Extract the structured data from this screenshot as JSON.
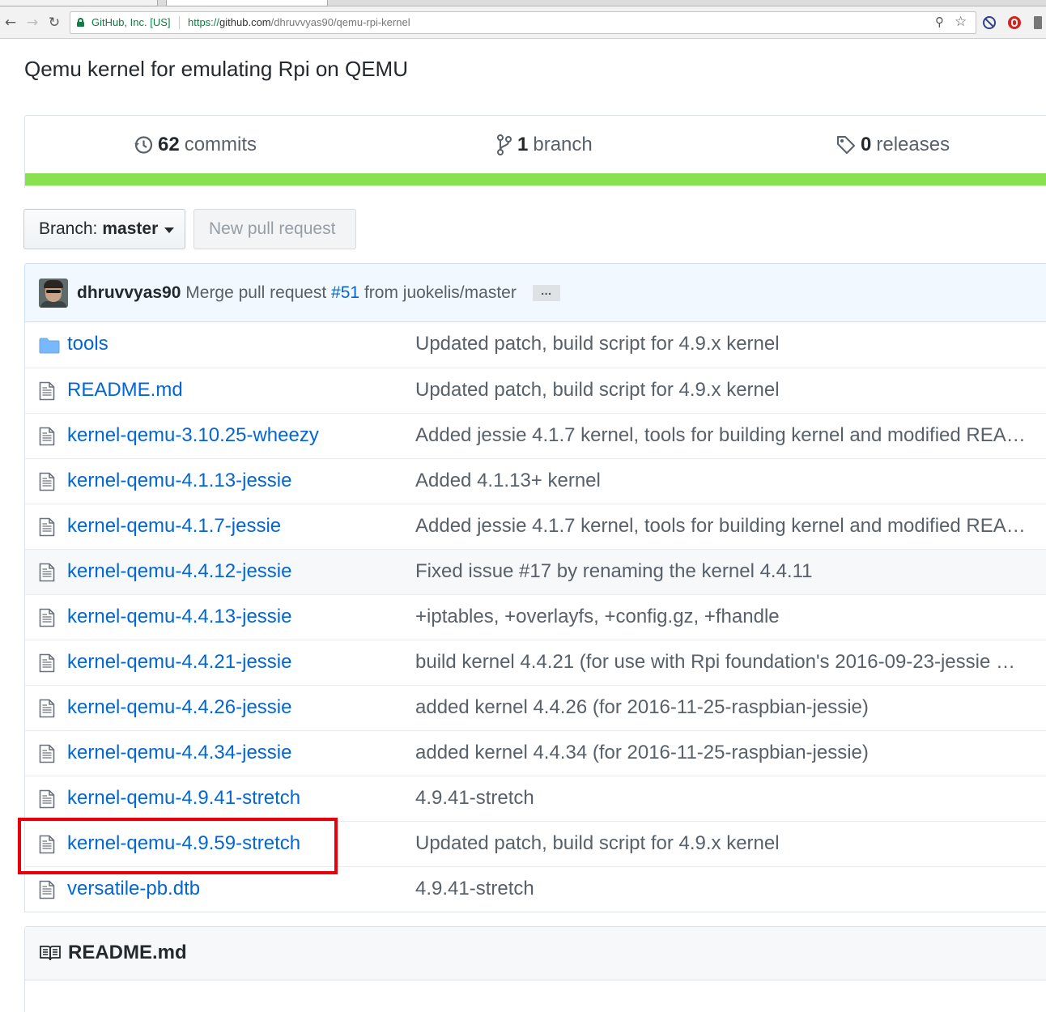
{
  "browser": {
    "site_identity": "GitHub, Inc. [US]",
    "url_protocol": "https://",
    "url_host": "github.com",
    "url_path": "/dhruvvyas90/qemu-rpi-kernel",
    "icons": [
      "back-icon",
      "forward-icon",
      "reload-icon",
      "lock-icon",
      "zoom-icon",
      "star-icon",
      "block-extension-icon",
      "record-extension-icon",
      "download-extension-icon"
    ]
  },
  "repo": {
    "description": "Qemu kernel for emulating Rpi on QEMU",
    "summary": {
      "commits_count": "62",
      "commits_label": "commits",
      "branches_count": "1",
      "branches_label": "branch",
      "releases_count": "0",
      "releases_label": "releases"
    },
    "language_color": "#89e051",
    "branch_button": {
      "label": "Branch:",
      "value": "master"
    },
    "new_pr_label": "New pull request",
    "latest_commit": {
      "author": "dhruvvyas90",
      "message_prefix": "Merge pull request",
      "pr_link": "#51",
      "message_suffix": "from juokelis/master",
      "ellipsis": "…"
    },
    "files": [
      {
        "type": "dir",
        "name": "tools",
        "message": "Updated patch, build script for 4.9.x kernel"
      },
      {
        "type": "file",
        "name": "README.md",
        "message": "Updated patch, build script for 4.9.x kernel"
      },
      {
        "type": "file",
        "name": "kernel-qemu-3.10.25-wheezy",
        "message": "Added jessie 4.1.7 kernel, tools for building kernel and modified REA…"
      },
      {
        "type": "file",
        "name": "kernel-qemu-4.1.13-jessie",
        "message": "Added 4.1.13+ kernel"
      },
      {
        "type": "file",
        "name": "kernel-qemu-4.1.7-jessie",
        "message": "Added jessie 4.1.7 kernel, tools for building kernel and modified REA…"
      },
      {
        "type": "file",
        "name": "kernel-qemu-4.4.12-jessie",
        "message": "Fixed issue #17 by renaming the kernel 4.4.11"
      },
      {
        "type": "file",
        "name": "kernel-qemu-4.4.13-jessie",
        "message": "+iptables, +overlayfs, +config.gz, +fhandle"
      },
      {
        "type": "file",
        "name": "kernel-qemu-4.4.21-jessie",
        "message": "build kernel 4.4.21 (for use with Rpi foundation's 2016-09-23-jessie …"
      },
      {
        "type": "file",
        "name": "kernel-qemu-4.4.26-jessie",
        "message": "added kernel 4.4.26 (for 2016-11-25-raspbian-jessie)"
      },
      {
        "type": "file",
        "name": "kernel-qemu-4.4.34-jessie",
        "message": "added kernel 4.4.34 (for 2016-11-25-raspbian-jessie)"
      },
      {
        "type": "file",
        "name": "kernel-qemu-4.9.41-stretch",
        "message": "4.9.41-stretch"
      },
      {
        "type": "file",
        "name": "kernel-qemu-4.9.59-stretch",
        "message": "Updated patch, build script for 4.9.x kernel"
      },
      {
        "type": "file",
        "name": "versatile-pb.dtb",
        "message": "4.9.41-stretch"
      }
    ],
    "highlight_color": "#e8000b",
    "readme_title": "README.md"
  }
}
